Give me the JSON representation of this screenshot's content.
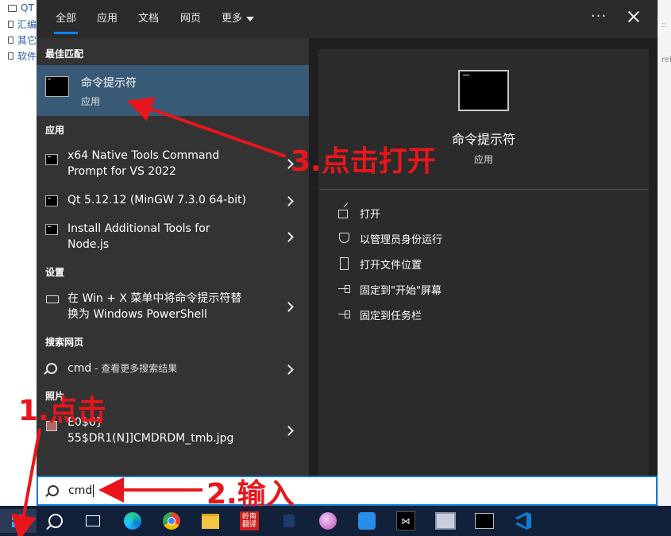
{
  "background_app": {
    "tree_items": [
      {
        "label": "QT"
      },
      {
        "label": "汇编"
      },
      {
        "label": "其它"
      },
      {
        "label": "软件"
      }
    ],
    "right_marks": [
      "::",
      "reb"
    ]
  },
  "start_menu": {
    "tabs": [
      "全部",
      "应用",
      "文档",
      "网页",
      "更多"
    ],
    "more_options_label": "···",
    "sections": {
      "best_match": "最佳匹配",
      "apps": "应用",
      "settings": "设置",
      "web": "搜索网页",
      "photos": "照片"
    },
    "best_match": {
      "title": "命令提示符",
      "subtitle": "应用",
      "icon": "terminal-icon"
    },
    "apps": [
      {
        "label": "x64 Native Tools Command\nPrompt for VS 2022"
      },
      {
        "label": "Qt 5.12.12 (MinGW 7.3.0 64-bit)"
      },
      {
        "label": "Install Additional Tools for\nNode.js"
      }
    ],
    "settings_items": [
      {
        "label": "在 Win + X 菜单中将命令提示符替\n换为 Windows PowerShell"
      }
    ],
    "web_item": {
      "query": "cmd",
      "suffix": " - 查看更多搜索结果"
    },
    "photo_item": {
      "label": "E0$6}\n55$DR1(N]]CMDRDM_tmb.jpg"
    },
    "detail": {
      "title": "命令提示符",
      "subtitle": "应用",
      "actions": [
        {
          "label": "打开",
          "icon": "open-icon"
        },
        {
          "label": "以管理员身份运行",
          "icon": "admin-shield-icon"
        },
        {
          "label": "打开文件位置",
          "icon": "file-location-icon"
        },
        {
          "label": "固定到\"开始\"屏幕",
          "icon": "pin-icon"
        },
        {
          "label": "固定到任务栏",
          "icon": "pin-icon"
        }
      ]
    }
  },
  "search_box": {
    "value": "cmd"
  },
  "taskbar": {
    "seal_text": "岭南翻译",
    "icons": [
      "windows-start-icon",
      "search-icon",
      "task-view-icon",
      "edge-icon",
      "chrome-icon",
      "file-explorer-icon",
      "seal-app-icon",
      "cat-app-icon",
      "orb-app-icon",
      "bird-app-icon",
      "dark-app-icon",
      "monitor-app-icon",
      "terminal-icon",
      "vscode-icon"
    ]
  },
  "annotations": {
    "step1": "1.点击",
    "step2": "2.输入",
    "step3": "3.点击打开",
    "color": "#e8161c"
  }
}
